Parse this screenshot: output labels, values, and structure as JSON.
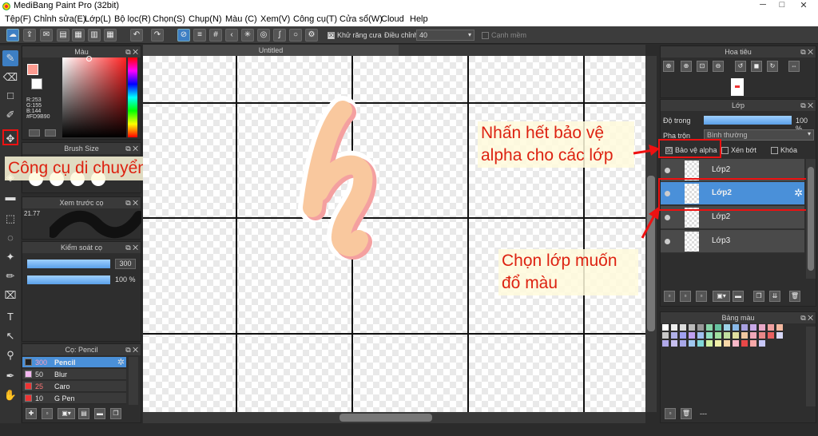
{
  "window": {
    "title": "MediBang Paint Pro (32bit)",
    "minimize": "─",
    "maximize": "□",
    "close": "✕"
  },
  "menu": [
    "Tệp(F)",
    "Chỉnh sửa(E)",
    "Lớp(L)",
    "Bộ lọc(R)",
    "Chọn(S)",
    "Chụp(N)",
    "Màu (C)",
    "Xem(V)",
    "Công cụ(T)",
    "Cửa sổ(W)",
    "Cloud",
    "Help"
  ],
  "toolbar": {
    "antialias_label": "Khử răng cưa",
    "antialias_checked": "☒",
    "adjust_label": "Điều chỉnh",
    "adjust_value": "40",
    "edge_label": "Cạnh mềm"
  },
  "color_panel": {
    "title": "Màu",
    "r": "R:253",
    "g": "G:155",
    "b": "B:144",
    "hex": "#FD9B90",
    "fg_color": "#FD9B90"
  },
  "brush_size_panel": {
    "title": "Brush Size"
  },
  "preview_panel": {
    "title": "Xem trước cọ",
    "size": "21.77"
  },
  "brush_control_panel": {
    "title": "Kiểm soát cọ",
    "size_value": "300",
    "opacity_value": "100 %"
  },
  "brush_list_panel": {
    "title": "Cọ: Pencil",
    "items": [
      {
        "size": "300",
        "name": "Pencil",
        "color": "#222222"
      },
      {
        "size": "50",
        "name": "Blur",
        "color": "#f4b6f0"
      },
      {
        "size": "25",
        "name": "Caro",
        "color": "#e33333"
      },
      {
        "size": "10",
        "name": "G Pen",
        "color": "#e33333"
      }
    ]
  },
  "document": {
    "tab_title": "Untitled"
  },
  "annotations": {
    "move_tool": "Công cụ di chuyển",
    "alpha_line1": "Nhấn hết bảo vệ",
    "alpha_line2": "alpha cho các lớp",
    "choose_line1": "Chọn lớp muốn",
    "choose_line2": "đổ màu"
  },
  "navigator_panel": {
    "title": "Hoa tiêu"
  },
  "layer_panel": {
    "title": "Lớp",
    "opacity_label": "Độ trong",
    "opacity_value": "100 %",
    "blend_label": "Pha trộn",
    "blend_value": "Bình thường",
    "protect_alpha_label": "Bảo vệ alpha",
    "protect_alpha_mark": "☒",
    "clipping_label": "Xén bớt",
    "lock_label": "Khóa",
    "layers": [
      "Lớp2",
      "Lớp2",
      "Lớp2",
      "Lớp3"
    ]
  },
  "palette_panel": {
    "title": "Bảng màu",
    "footer_text": "---",
    "colors": [
      "#ffffff",
      "#eeeeee",
      "#dddddd",
      "#bbbbbb",
      "#999999",
      "#88d4a8",
      "#66c2a0",
      "#9dd3e8",
      "#88b8e8",
      "#a8a0e0",
      "#c8a8e8",
      "#e8a8c8",
      "#f0a0a0",
      "#f4b8a0",
      "#c8c8c8",
      "#b0b0e8",
      "#a0a0f0",
      "#c0a0f0",
      "#a0c0f0",
      "#90e0c0",
      "#a0e0a0",
      "#c0e0a0",
      "#e0e0a0",
      "#f0c8a0",
      "#f0a8b8",
      "#e88888",
      "#e86060",
      "#d8d8f8",
      "#b0a8e8",
      "#c8c0f0",
      "#a8a8e8",
      "#a0c8f0",
      "#80d8d8",
      "#d0f0a0",
      "#f0f0a8",
      "#f8d8a8",
      "#f8b8c8",
      "#e84848",
      "#f8a8a8",
      "#c8c8f8"
    ]
  }
}
